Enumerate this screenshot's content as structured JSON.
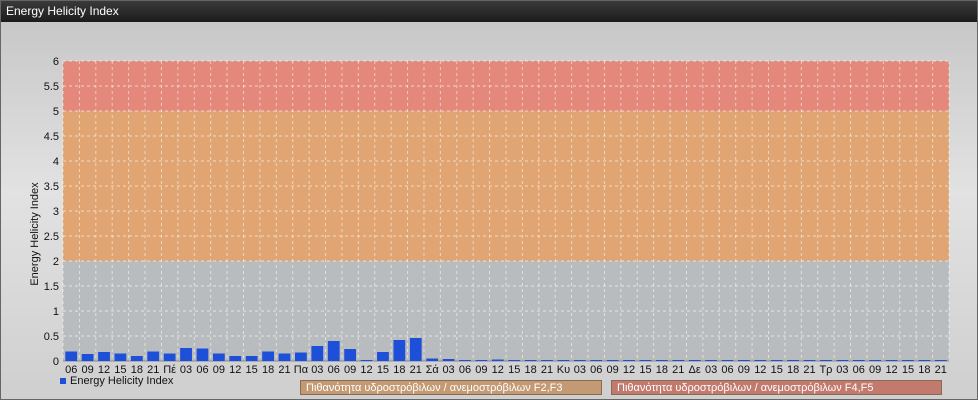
{
  "window": {
    "title": "Energy Helicity Index"
  },
  "legend": {
    "series_label": "Energy Helicity Index",
    "band_f23_label": "Πιθανότητα υδροστρόβιλων / ανεμοστρόβιλων F2,F3",
    "band_f45_label": "Πιθανότητα υδροστρόβιλων / ανεμοστρόβιλων F4,F5"
  },
  "colors": {
    "bar": "#1d4fd8",
    "band_low": "#b9bcbe",
    "band_mid": "#e0a572",
    "band_high": "#e3887a",
    "band_f23_button": "#c49a74",
    "band_f45_button": "#c27a6e"
  },
  "chart_data": {
    "type": "bar",
    "ylabel": "Energy Helicity Index",
    "ylim": [
      0,
      6
    ],
    "yticks": [
      "0",
      "0.5",
      "1",
      "1.5",
      "2",
      "2.5",
      "3",
      "3.5",
      "4",
      "4.5",
      "5",
      "5.5",
      "6"
    ],
    "bands": [
      {
        "from": 0,
        "to": 2
      },
      {
        "from": 2,
        "to": 5
      },
      {
        "from": 5,
        "to": 6
      }
    ],
    "grid": true,
    "legend_position": "bottom-left",
    "categories": [
      "06",
      "09",
      "12",
      "15",
      "18",
      "21",
      "Πέ",
      "03",
      "06",
      "09",
      "12",
      "15",
      "18",
      "21",
      "Πα",
      "03",
      "06",
      "09",
      "12",
      "15",
      "18",
      "21",
      "Σά",
      "03",
      "06",
      "09",
      "12",
      "15",
      "18",
      "21",
      "Κυ",
      "03",
      "06",
      "09",
      "12",
      "15",
      "18",
      "21",
      "Δε",
      "03",
      "06",
      "09",
      "12",
      "15",
      "18",
      "21",
      "Τρ",
      "03",
      "06",
      "09",
      "12",
      "15",
      "18",
      "21"
    ],
    "series": [
      {
        "name": "Energy Helicity Index",
        "values": [
          0.19,
          0.14,
          0.18,
          0.15,
          0.1,
          0.19,
          0.15,
          0.26,
          0.25,
          0.15,
          0.1,
          0.1,
          0.19,
          0.15,
          0.17,
          0.3,
          0.4,
          0.24,
          0.02,
          0.18,
          0.42,
          0.46,
          0.05,
          0.04,
          0.02,
          0.02,
          0.03,
          0.02,
          0.02,
          0.02,
          0.02,
          0.02,
          0.02,
          0.02,
          0.02,
          0.02,
          0.02,
          0.02,
          0.02,
          0.02,
          0.02,
          0.02,
          0.02,
          0.02,
          0.02,
          0.02,
          0.02,
          0.02,
          0.02,
          0.02,
          0.02,
          0.02,
          0.02,
          0.02
        ]
      }
    ]
  }
}
